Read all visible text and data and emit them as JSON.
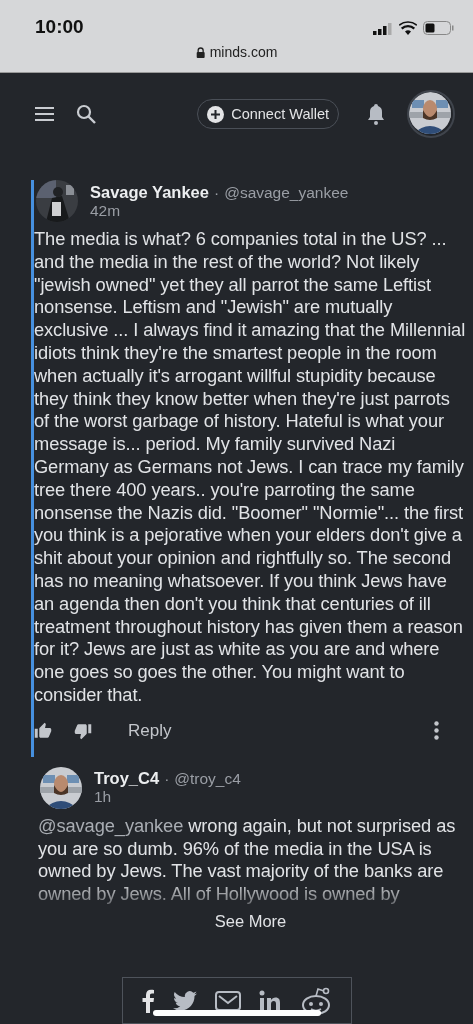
{
  "status_bar": {
    "time": "10:00",
    "url": "minds.com"
  },
  "nav": {
    "connect_button": "Connect Wallet"
  },
  "comments": [
    {
      "name": "Savage Yankee",
      "separator": "·",
      "handle": "@savage_yankee",
      "time": "42m",
      "highlighted": true,
      "text": "The media is what? 6 companies total in the US? ... and the media in the rest of the world? Not likely \"jewish owned\" yet they all parrot the same Leftist nonsense. Leftism and \"Jewish\" are mutually exclusive ... I always find it amazing that the Millennial idiots think they're the smartest people in the room when actually it's arrogant willful stupidity because they think they know better when they're just parrots of the worst garbage of history. Hateful is what your message is... period. My family survived Nazi Germany as Germans not Jews. I can trace my family tree there 400 years.. you're parroting the same nonsense the Nazis did. \"Boomer\" \"Normie\"... the first you think is a pejorative when your elders don't give a shit about your opinion and rightfully so. The second has no meaning whatsoever. If you think Jews have an agenda then don't you think that centuries of ill treatment throughout history has given them a reason for it? Jews are just as white as you are and where one goes so goes the other. You might want to consider that.",
      "reply": "Reply",
      "collapsed": false
    },
    {
      "name": "Troy_C4",
      "separator": "·",
      "handle": "@troy_c4",
      "time": "1h",
      "highlighted": false,
      "mention": "@savage_yankee",
      "text": "wrong again, but not surprised as you are so dumb. 96% of the media in the USA is owned by Jews. The vast majority of the banks are owned by Jews. All of Hollywood is owned by",
      "collapsed": true,
      "see_more": "See More"
    }
  ]
}
